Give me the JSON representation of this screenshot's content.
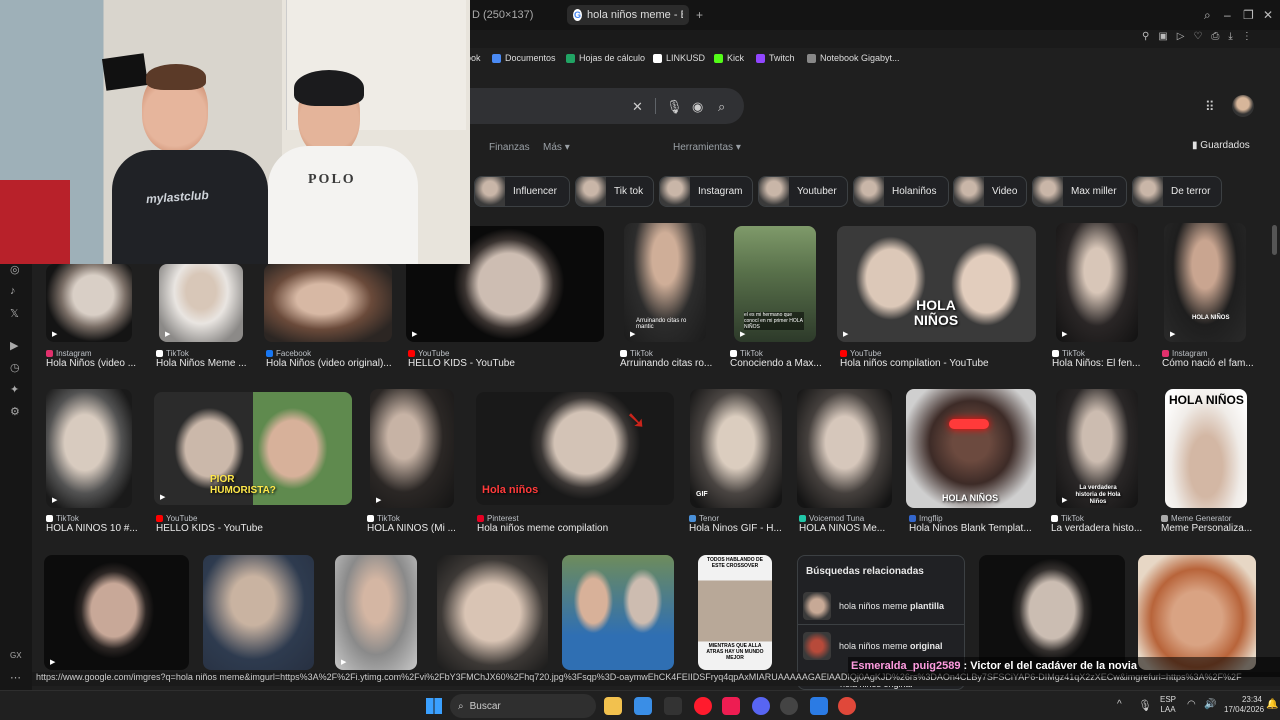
{
  "tabs": {
    "prev": "D (250×137)",
    "active": "hola niños meme - Buscar",
    "plus": "+"
  },
  "bookmarks": [
    {
      "label": "ook",
      "color": "#4a90d9"
    },
    {
      "label": "Documentos",
      "color": "#4a8af4"
    },
    {
      "label": "Hojas de cálculo",
      "color": "#21a464"
    },
    {
      "label": "LINKUSD",
      "color": "#ffffff"
    },
    {
      "label": "Kick",
      "color": "#53fc18"
    },
    {
      "label": "Twitch",
      "color": "#9146ff"
    },
    {
      "label": "Notebook Gigabyt...",
      "color": "#888888"
    }
  ],
  "nav": {
    "finanzas": "Finanzas",
    "mas": "Más",
    "herramientas": "Herramientas",
    "guardados": "Guardados"
  },
  "chips": [
    "Influencer",
    "Tik tok",
    "Instagram",
    "Youtuber",
    "Holaniños",
    "Video",
    "Max miller",
    "De terror"
  ],
  "row1": [
    {
      "src": "Instagram",
      "title": "Hola Niños (video ...",
      "sc": "#e1306c"
    },
    {
      "src": "TikTok",
      "title": "Hola Niños Meme ...",
      "sc": "#ffffff"
    },
    {
      "src": "Facebook",
      "title": "Hola Niños (video original)...",
      "sc": "#1877f2"
    },
    {
      "src": "YouTube",
      "title": "HELLO KIDS - YouTube",
      "sc": "#ff0000"
    },
    {
      "src": "TikTok",
      "title": "Arruinando citas ro...",
      "sc": "#ffffff"
    },
    {
      "src": "TikTok",
      "title": "Conociendo a Max...",
      "sc": "#ffffff"
    },
    {
      "src": "YouTube",
      "title": "Hola niños compilation - YouTube",
      "sc": "#ff0000"
    },
    {
      "src": "TikTok",
      "title": "Hola Niños: El fen...",
      "sc": "#ffffff"
    },
    {
      "src": "Instagram",
      "title": "Cómo nació el fam...",
      "sc": "#e1306c"
    }
  ],
  "row2": [
    {
      "src": "TikTok",
      "title": "HOLA NIÑOS 10 #...",
      "sc": "#ffffff"
    },
    {
      "src": "YouTube",
      "title": "HELLO KIDS - YouTube",
      "sc": "#ff0000"
    },
    {
      "src": "TikTok",
      "title": "HOLA NIÑOS (Mi ...",
      "sc": "#ffffff"
    },
    {
      "src": "Pinterest",
      "title": "Hola niños meme compilation",
      "sc": "#e60023"
    },
    {
      "src": "Tenor",
      "title": "Hola Ninos GIF - H...",
      "sc": "#4a90d9"
    },
    {
      "src": "Voicemod Tuna",
      "title": "HOLA NIÑOS Me...",
      "sc": "#21c7a8"
    },
    {
      "src": "Imgflip",
      "title": "Hola Ninos Blank Templat...",
      "sc": "#3366cc"
    },
    {
      "src": "TikTok",
      "title": "La verdadera histo...",
      "sc": "#ffffff"
    },
    {
      "src": "Meme Generator",
      "title": "Meme Personaliza...",
      "sc": "#aaaaaa"
    }
  ],
  "overlays": {
    "r1c7": "HOLA NIÑOS",
    "r1c5": "Arruinando citas ro mantic",
    "r1c6": "el es mi hermano que conocí en mi primer HOLA NIÑOS",
    "r1c9": "HOLA NIÑOS",
    "r2c2": "PIOR HUMORISTA?",
    "r2c4": "Hola niños",
    "r2c5": "GIF",
    "r2c7": "HOLA NIÑOS",
    "r2c8": "La verdadera historia de Hola Niños",
    "r2c9": "HOLA NIÑOS",
    "r3c6a": "TODOS HABLANDO DE ESTE CROSSOVER",
    "r3c6b": "MIENTRAS QUE ALLA ATRAS HAY UN MUNDO MEJOR"
  },
  "related": {
    "heading": "Búsquedas relacionadas",
    "items": [
      {
        "pre": "hola niños meme ",
        "bold": "plantilla"
      },
      {
        "pre": "hola niños meme ",
        "bold": "original"
      }
    ],
    "cut": "hola niños original"
  },
  "statusurl": "https://www.google.com/imgres?q=hola niños meme&imgurl=https%3A%2F%2Fi.ytimg.com%2Fvi%2FbY3FMChJX60%2Fhq720.jpg%3Fsqp%3D-oaymwEhCK4FEIIDSFryq4qpAxMIARUAAAAAGAElAADIQj0AgKJD%26rs%3DAOn4CLBy7SFSCiYAP6-DIMgz41qX2zXECw&imgrefurl=https%3A%2F%2F",
  "chat": {
    "user": "Esmeralda_puig2589",
    "msg": " : Victor el del cadáver de la novia"
  },
  "taskbar": {
    "search": "Buscar",
    "lang1": "ESP",
    "lang2": "LAA",
    "time": "23:34",
    "date": "17/04/2026"
  },
  "webcam": {
    "shirt1": "POLO",
    "shirt2": "mylastclub"
  },
  "sidebar_gx": "GX"
}
